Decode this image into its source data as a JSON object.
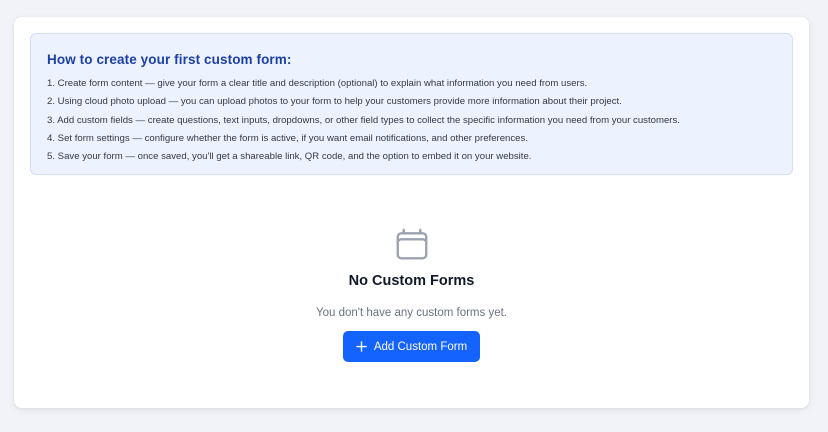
{
  "howto": {
    "title": "How to create your first custom form:",
    "steps": [
      "1. Create form content — give your form a clear title and description (optional) to explain what information you need from users.",
      "2. Using cloud photo upload — you can upload photos to your form to help your customers provide more information about their project.",
      "3. Add custom fields — create questions, text inputs, dropdowns, or other field types to collect the specific information you need from your customers.",
      "4. Set form settings — configure whether the form is active, if you want email notifications, and other preferences.",
      "5. Save your form — once saved, you'll get a shareable link, QR code, and the option to embed it on your website."
    ]
  },
  "empty_state": {
    "icon": "calendar-icon",
    "title": "No Custom Forms",
    "subtitle": "You don't have any custom forms yet.",
    "button_icon": "plus-icon",
    "button_label": "Add Custom Form"
  },
  "colors": {
    "accent": "#1463ff",
    "howto_bg": "#edf3fe",
    "howto_title": "#1c3fa6"
  }
}
